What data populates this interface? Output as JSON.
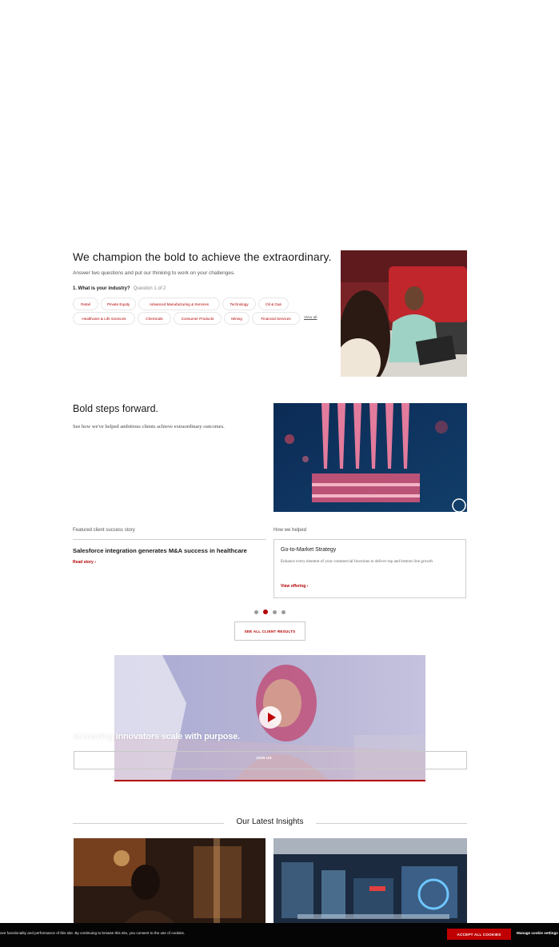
{
  "champion": {
    "title": "We champion the bold to achieve the extraordinary.",
    "subtitle": "Answer two questions and put our thinking to work on your challenges.",
    "question": "1. What is your industry?",
    "question_count": "Question 1 of 2",
    "industries": [
      "Retail",
      "Private Equity",
      "Advanced Manufacturing & Services",
      "Technology",
      "Oil & Gas",
      "Healthcare & Life Sciences",
      "Chemicals",
      "Consumer Products",
      "Mining",
      "Financial Services"
    ],
    "view_all": "View all"
  },
  "bold_steps": {
    "title": "Bold steps forward.",
    "subtitle": "See how we've helped ambitious clients achieve extraordinary outcomes.",
    "featured_label": "Featured client success story",
    "helped_label": "How we helped",
    "story_title": "Salesforce integration generates M&A success in healthcare",
    "story_link": "Read story ›",
    "offering_title": "Go-to-Market Strategy",
    "offering_desc": "Enhance every element of your commercial functions to deliver top and bottom line growth",
    "offering_link": "View offering ›",
    "carousel": {
      "count": 4,
      "active_index": 1
    },
    "see_all": "SEE ALL CLIENT RESULTS"
  },
  "video": {
    "headline": "st-moving innovators scale with purpose.",
    "join": "JOIN US"
  },
  "insights": {
    "title": "Our Latest Insights"
  },
  "cookie": {
    "text": "ove functionality and performance of this site. By continuing to browse this site, you consent to the use of cookies.",
    "accept": "ACCEPT ALL COOKIES",
    "manage": "Manage cookie settings"
  },
  "colors": {
    "accent": "#b30000",
    "cookie_bar": "#050505"
  }
}
